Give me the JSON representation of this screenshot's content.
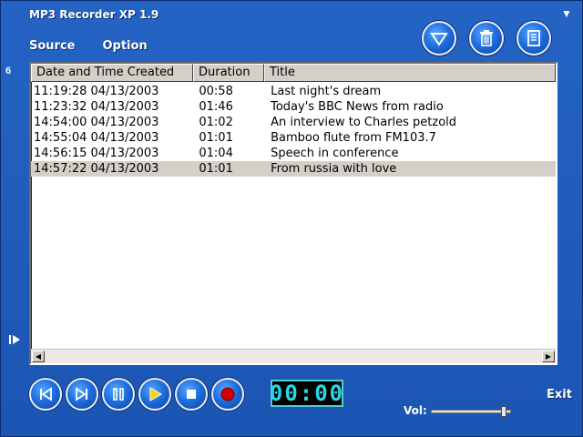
{
  "window": {
    "title": "MP3 Recorder XP 1.9",
    "minimize_glyph": "▼"
  },
  "menu": [
    {
      "label": "Source"
    },
    {
      "label": "Option"
    }
  ],
  "toolbar": {
    "icons": [
      "down-triangle-icon",
      "trash-icon",
      "document-icon"
    ]
  },
  "side": {
    "count": "6",
    "play_glyph": "▶"
  },
  "list": {
    "columns": [
      "Date and Time Created",
      "Duration",
      "Title"
    ],
    "rows": [
      {
        "created": "11:19:28  04/13/2003",
        "duration": "00:58",
        "title": "Last night's dream",
        "selected": false
      },
      {
        "created": "11:23:32  04/13/2003",
        "duration": "01:46",
        "title": "Today's BBC News from radio",
        "selected": false
      },
      {
        "created": "14:54:00  04/13/2003",
        "duration": "01:02",
        "title": "An interview to Charles petzold",
        "selected": false
      },
      {
        "created": "14:55:04  04/13/2003",
        "duration": "01:01",
        "title": "Bamboo flute from FM103.7",
        "selected": false
      },
      {
        "created": "14:56:15  04/13/2003",
        "duration": "01:04",
        "title": "Speech in conference",
        "selected": false
      },
      {
        "created": "14:57:22  04/13/2003",
        "duration": "01:01",
        "title": "From russia with love",
        "selected": true
      }
    ]
  },
  "controls": {
    "buttons": [
      "previous-icon",
      "next-icon",
      "pause-icon",
      "play-icon",
      "stop-icon",
      "record-icon"
    ]
  },
  "timer": {
    "display": "00:00"
  },
  "exit": {
    "label": "Exit"
  },
  "volume": {
    "label": "Vol:",
    "level": 0.95
  },
  "colors": {
    "accent": "#1f5fbf",
    "record": "#d40000",
    "play": "#f2d200",
    "lcd": "#27d7e8"
  }
}
